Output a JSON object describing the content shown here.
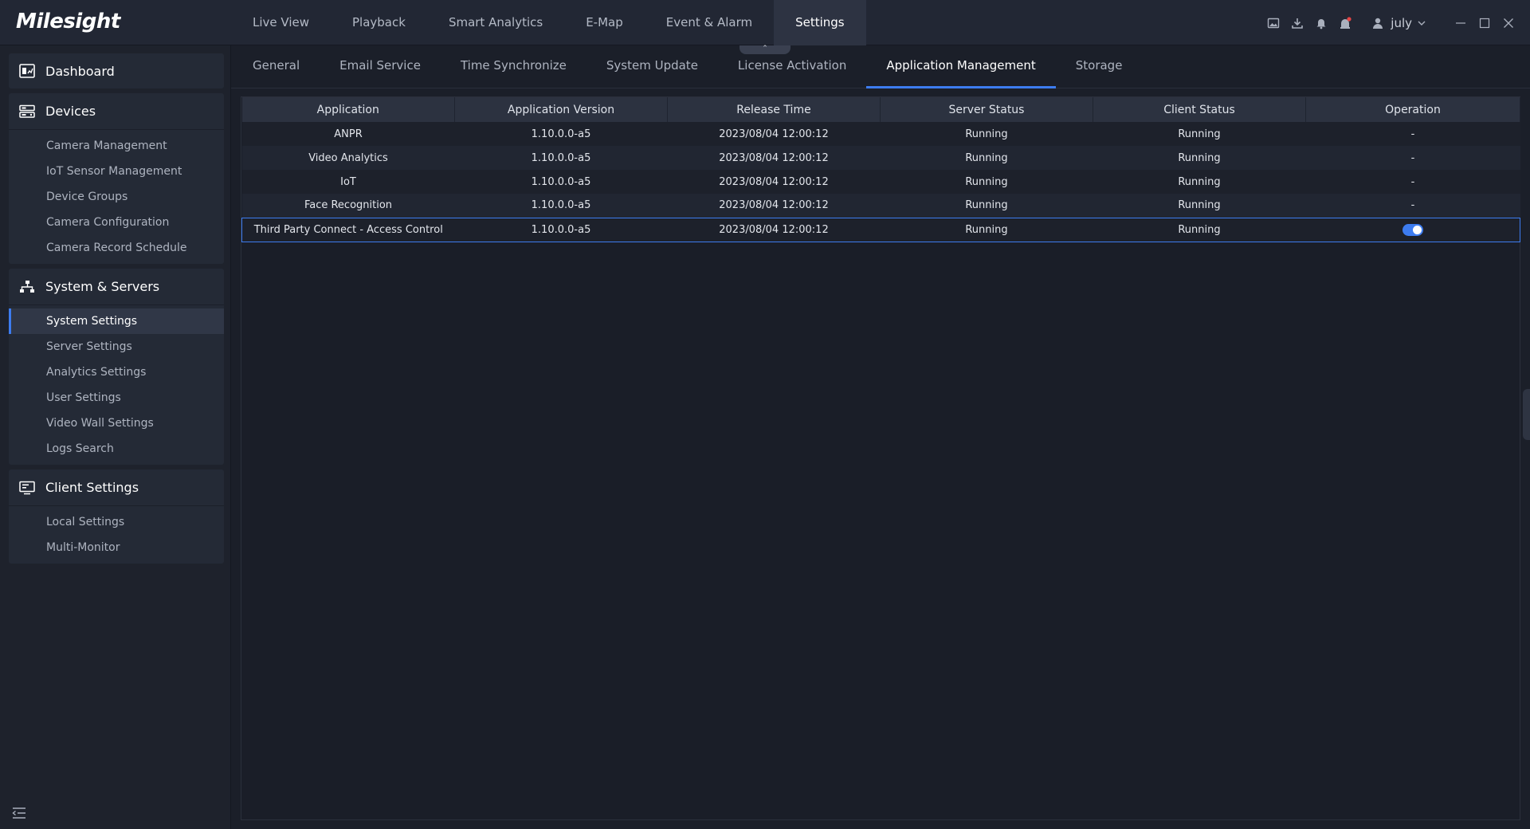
{
  "app": {
    "logo": "Milesight"
  },
  "main_nav": [
    {
      "label": "Live View"
    },
    {
      "label": "Playback"
    },
    {
      "label": "Smart Analytics"
    },
    {
      "label": "E-Map"
    },
    {
      "label": "Event & Alarm"
    },
    {
      "label": "Settings",
      "active": true
    }
  ],
  "collapse_glyph": "⌃",
  "user": {
    "name": "july"
  },
  "sidebar": {
    "dashboard": {
      "label": "Dashboard"
    },
    "devices": {
      "label": "Devices",
      "items": [
        "Camera Management",
        "IoT Sensor Management",
        "Device Groups",
        "Camera Configuration",
        "Camera Record Schedule"
      ]
    },
    "system": {
      "label": "System & Servers",
      "items": [
        "System Settings",
        "Server Settings",
        "Analytics Settings",
        "User Settings",
        "Video Wall Settings",
        "Logs Search"
      ],
      "active_index": 0
    },
    "client": {
      "label": "Client Settings",
      "items": [
        "Local Settings",
        "Multi-Monitor"
      ]
    }
  },
  "subtabs": [
    {
      "label": "General"
    },
    {
      "label": "Email Service"
    },
    {
      "label": "Time Synchronize"
    },
    {
      "label": "System Update"
    },
    {
      "label": "License Activation"
    },
    {
      "label": "Application Management",
      "active": true
    },
    {
      "label": "Storage"
    }
  ],
  "table": {
    "columns": [
      "Application",
      "Application Version",
      "Release Time",
      "Server Status",
      "Client Status",
      "Operation"
    ],
    "rows": [
      {
        "application": "ANPR",
        "version": "1.10.0.0-a5",
        "release": "2023/08/04 12:00:12",
        "server": "Running",
        "client": "Running",
        "operation": "-"
      },
      {
        "application": "Video Analytics",
        "version": "1.10.0.0-a5",
        "release": "2023/08/04 12:00:12",
        "server": "Running",
        "client": "Running",
        "operation": "-"
      },
      {
        "application": "IoT",
        "version": "1.10.0.0-a5",
        "release": "2023/08/04 12:00:12",
        "server": "Running",
        "client": "Running",
        "operation": "-"
      },
      {
        "application": "Face Recognition",
        "version": "1.10.0.0-a5",
        "release": "2023/08/04 12:00:12",
        "server": "Running",
        "client": "Running",
        "operation": "-"
      },
      {
        "application": "Third Party Connect - Access Control",
        "version": "1.10.0.0-a5",
        "release": "2023/08/04 12:00:12",
        "server": "Running",
        "client": "Running",
        "operation": "toggle",
        "enabled": true
      }
    ]
  },
  "colors": {
    "accent": "#3d7cf0",
    "background": "#1b1f29",
    "alert": "#e64545"
  }
}
